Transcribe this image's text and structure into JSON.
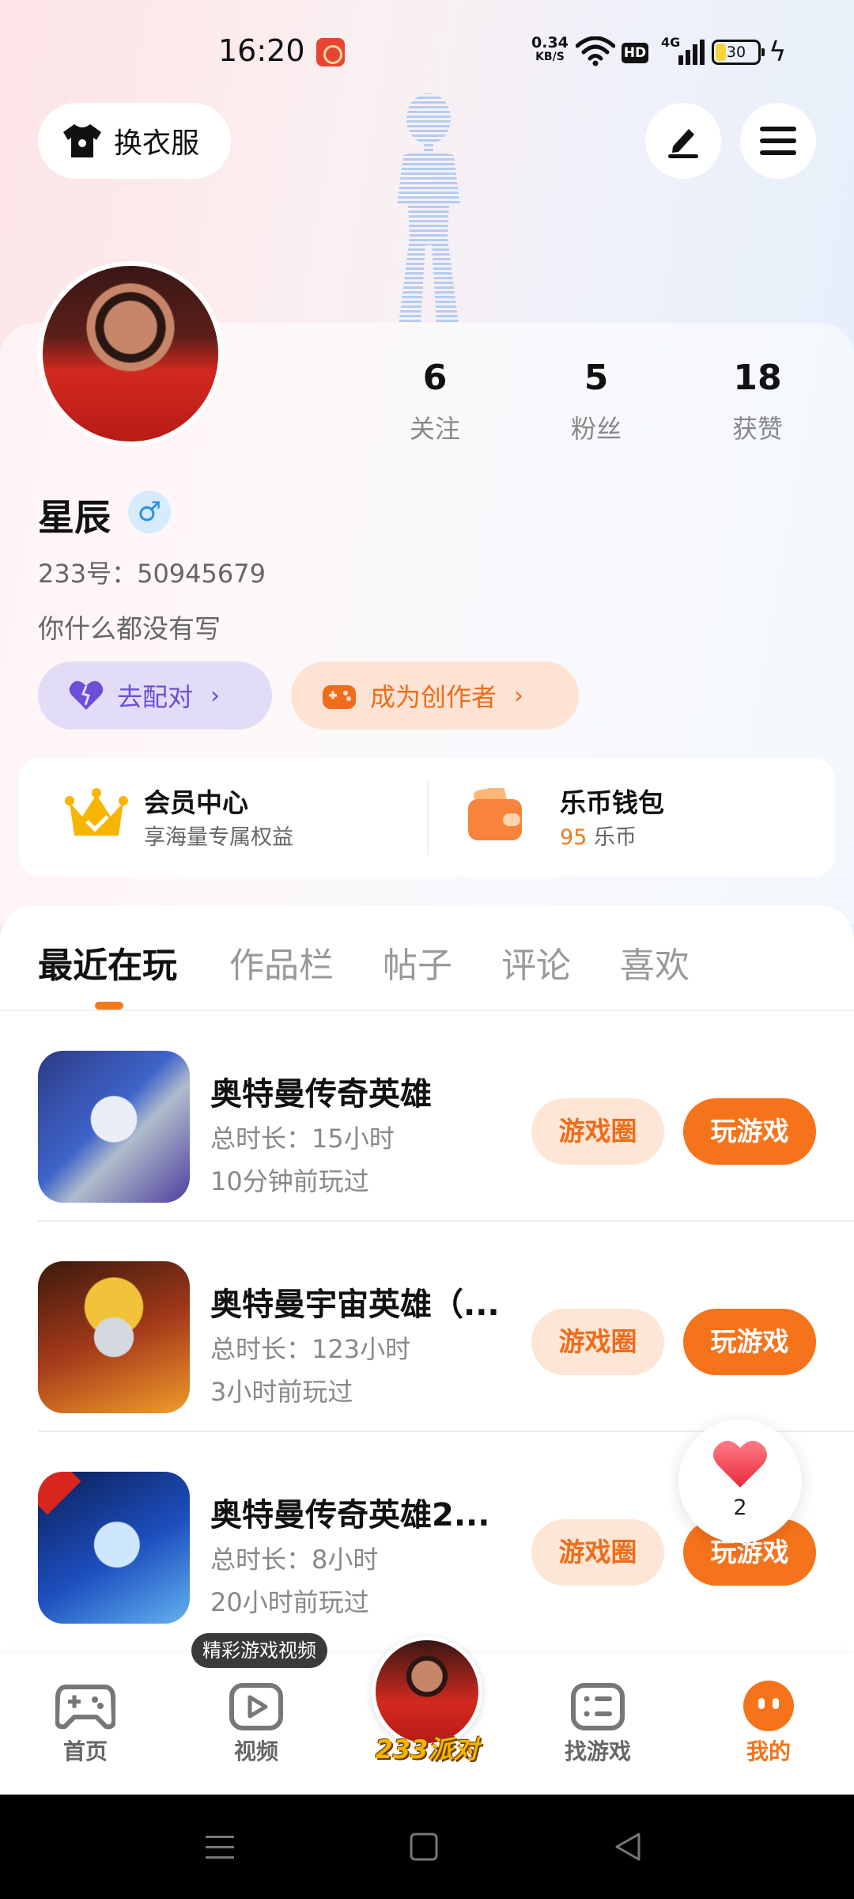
{
  "status_bar": {
    "time": "16:20",
    "net_speed_value": "0.34",
    "net_speed_unit": "KB/S",
    "hd": "HD",
    "network": "4G",
    "battery": "30",
    "battery_level": 0.3
  },
  "header": {
    "outfit_label": "换衣服",
    "icons": [
      "shirt-icon",
      "edit-icon",
      "menu-icon"
    ]
  },
  "profile": {
    "stats": [
      {
        "value": "6",
        "label": "关注"
      },
      {
        "value": "5",
        "label": "粉丝"
      },
      {
        "value": "18",
        "label": "获赞"
      }
    ],
    "name": "星辰",
    "gender_symbol": "♂",
    "id_text": "233号：50945679",
    "bio": "你什么都没有写",
    "match_label": "去配对",
    "creator_label": "成为创作者",
    "arrow": "›"
  },
  "vip": {
    "member_title": "会员中心",
    "member_sub": "享海量专属权益",
    "wallet_title": "乐币钱包",
    "wallet_amount": "95",
    "wallet_unit": " 乐币"
  },
  "tabs": [
    "最近在玩",
    "作品栏",
    "帖子",
    "评论",
    "喜欢"
  ],
  "games": [
    {
      "name": "奥特曼传奇英雄",
      "time": "总时长：15小时",
      "last": "10分钟前玩过",
      "circle": "游戏圈",
      "play": "玩游戏"
    },
    {
      "name": "奥特曼宇宙英雄（...",
      "time": "总时长：123小时",
      "last": "3小时前玩过",
      "circle": "游戏圈",
      "play": "玩游戏"
    },
    {
      "name": "奥特曼传奇英雄2...",
      "time": "总时长：8小时",
      "last": "20小时前玩过",
      "circle": "游戏圈",
      "play": "玩游戏"
    }
  ],
  "like_float": {
    "count": "2"
  },
  "bottom_nav": {
    "tooltip": "精彩游戏视频",
    "items": [
      "首页",
      "视频",
      "找游戏",
      "我的"
    ],
    "party": "233派对"
  },
  "colors": {
    "accent": "#f5731b",
    "match": "#6a4fd8",
    "gender": "#2d8de3",
    "vip_gold": "#f5b400"
  }
}
